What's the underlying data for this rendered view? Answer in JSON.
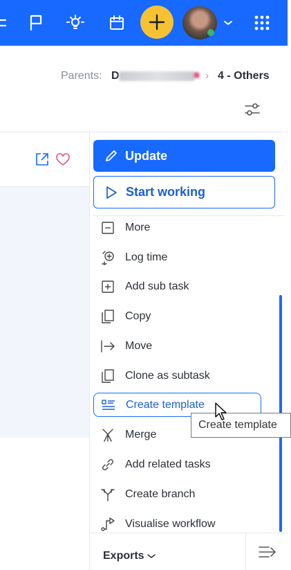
{
  "colors": {
    "brand_blue": "#1769ff",
    "accent_yellow": "#f6c234",
    "heart_red": "#e2587a"
  },
  "topbar": {
    "icons": [
      "menu-icon",
      "flag-icon",
      "idea-bulb-icon",
      "calendar-icon",
      "add-icon",
      "avatar",
      "chevron-down-icon",
      "apps-grid-icon"
    ]
  },
  "breadcrumb": {
    "label": "Parents:",
    "parent_visible": "D",
    "separator": "›",
    "current": "4 - Others"
  },
  "actions": {
    "update_label": "Update",
    "start_label": "Start working"
  },
  "menu": {
    "items": [
      {
        "label": "More",
        "icon": "minus-box-icon"
      },
      {
        "label": "Log time",
        "icon": "alarm-add-icon"
      },
      {
        "label": "Add sub task",
        "icon": "plus-box-icon"
      },
      {
        "label": "Copy",
        "icon": "copy-icon"
      },
      {
        "label": "Move",
        "icon": "move-arrow-icon"
      },
      {
        "label": "Clone as subtask",
        "icon": "clone-icon"
      },
      {
        "label": "Create template",
        "icon": "template-list-icon"
      },
      {
        "label": "Merge",
        "icon": "merge-icon"
      },
      {
        "label": "Add related tasks",
        "icon": "link-icon"
      },
      {
        "label": "Create branch",
        "icon": "branch-icon"
      },
      {
        "label": "Visualise workflow",
        "icon": "workflow-icon"
      }
    ]
  },
  "tooltip": {
    "text": "Create template"
  },
  "footer": {
    "exports_label": "Exports"
  }
}
